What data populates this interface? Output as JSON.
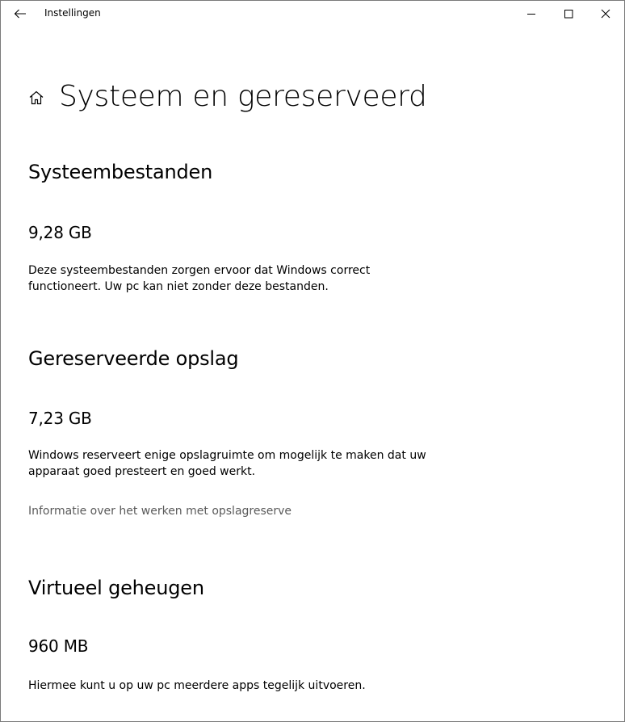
{
  "window": {
    "app_title": "Instellingen"
  },
  "page": {
    "title": "Systeem en gereserveerd"
  },
  "sections": {
    "system_files": {
      "heading": "Systeembestanden",
      "size": "9,28 GB",
      "description_line1": "Deze systeembestanden zorgen ervoor dat Windows correct",
      "description_line2": "functioneert. Uw pc kan niet zonder deze bestanden."
    },
    "reserved_storage": {
      "heading": "Gereserveerde opslag",
      "size": "7,23 GB",
      "description_line1": "Windows reserveert enige opslagruimte om mogelijk te maken dat uw",
      "description_line2": "apparaat goed presteert en goed werkt.",
      "link": "Informatie over het werken met opslagreserve"
    },
    "virtual_memory": {
      "heading": "Virtueel geheugen",
      "size": "960 MB",
      "description": "Hiermee kunt u op uw pc meerdere apps tegelijk uitvoeren."
    }
  },
  "icons": {
    "back": "back-arrow-icon",
    "home": "home-icon",
    "minimize": "minimize-icon",
    "maximize": "maximize-icon",
    "close": "close-icon"
  },
  "colors": {
    "link": "#5a5a5a",
    "window_border": "#7a7a7a"
  }
}
